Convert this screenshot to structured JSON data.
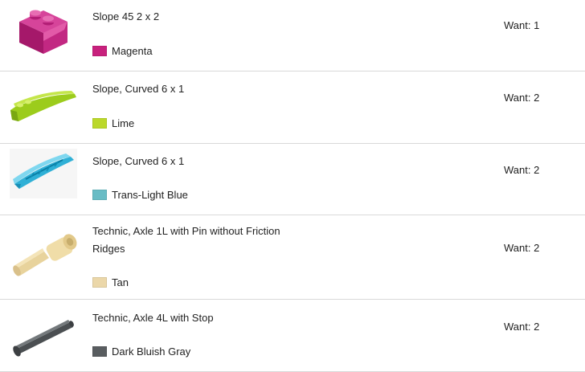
{
  "items": [
    {
      "name": "Slope 45 2 x 2",
      "color_name": "Magenta",
      "color_hex": "#c8217d",
      "want": "Want: 1",
      "icon": "slope-45-2x2-part-icon"
    },
    {
      "name": "Slope, Curved 6 x 1",
      "color_name": "Lime",
      "color_hex": "#bbd82a",
      "want": "Want: 2",
      "icon": "slope-curved-6x1-part-icon"
    },
    {
      "name": "Slope, Curved 6 x 1",
      "color_name": "Trans-Light Blue",
      "color_hex": "#68bcc5",
      "want": "Want: 2",
      "icon": "slope-curved-6x1-trans-part-icon"
    },
    {
      "name": "Technic, Axle 1L with Pin without Friction Ridges",
      "color_name": "Tan",
      "color_hex": "#ebd7a9",
      "want": "Want: 2",
      "icon": "technic-axle-pin-part-icon"
    },
    {
      "name": "Technic, Axle 4L with Stop",
      "color_name": "Dark Bluish Gray",
      "color_hex": "#595d60",
      "want": "Want: 2",
      "icon": "technic-axle-4l-part-icon"
    }
  ]
}
